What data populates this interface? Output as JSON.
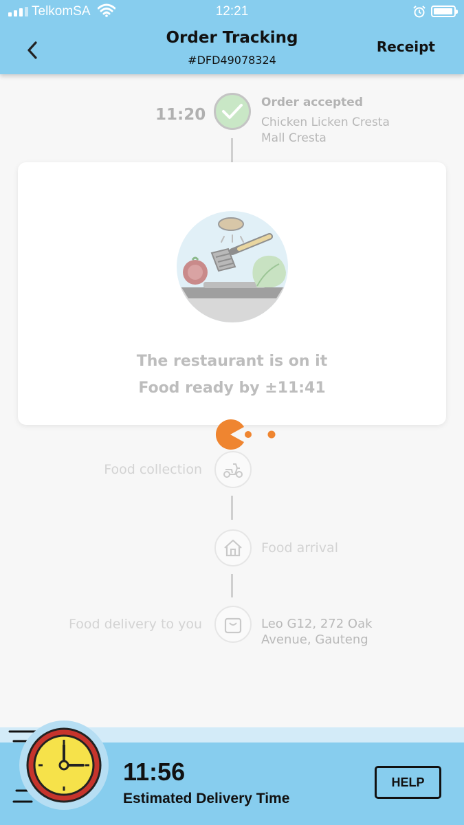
{
  "status_bar": {
    "carrier": "TelkomSA",
    "time": "12:21",
    "battery_level": 0.95,
    "signal_bars": 3
  },
  "header": {
    "title": "Order Tracking",
    "order_number": "#DFD49078324",
    "receipt_label": "Receipt",
    "back_icon": "chevron-left-icon"
  },
  "timeline": {
    "accepted": {
      "time": "11:20",
      "title": "Order accepted",
      "restaurant_line1": "Chicken Licken Cresta",
      "restaurant_line2": "Mall Cresta",
      "icon": "checkmark-icon"
    },
    "status_card": {
      "line1": "The restaurant is on it",
      "line2": "Food ready by ±11:41",
      "illustration": "cooking-pan-illustration"
    },
    "collection": {
      "label": "Food collection",
      "icon": "scooter-icon"
    },
    "arrival": {
      "label": "Food arrival",
      "icon": "house-icon"
    },
    "delivery": {
      "label": "Food delivery to you",
      "address_line1": "Leo G12, 272 Oak",
      "address_line2": "Avenue, Gauteng",
      "icon": "shopping-bag-icon"
    }
  },
  "footer": {
    "eta_time": "11:56",
    "eta_label": "Estimated Delivery Time",
    "help_label": "HELP",
    "clock_icon": "clock-icon"
  },
  "colors": {
    "header_bg": "#87cdee",
    "accent_orange": "#ef8530",
    "accepted_green": "#c9e7c6"
  }
}
